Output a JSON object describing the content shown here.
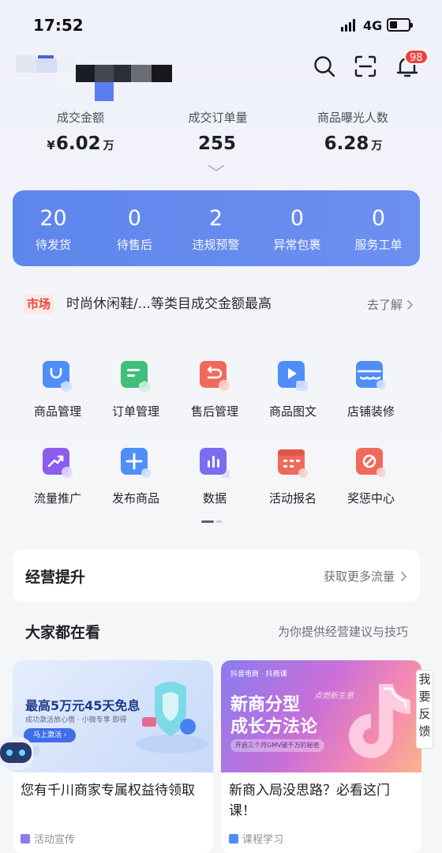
{
  "status_bar": {
    "time": "17:52",
    "network": "4G"
  },
  "header": {
    "notification_count": "98"
  },
  "metrics": [
    {
      "label": "成交金额",
      "currency": "¥",
      "value": "6.02",
      "unit": "万"
    },
    {
      "label": "成交订单量",
      "currency": "",
      "value": "255",
      "unit": ""
    },
    {
      "label": "商品曝光人数",
      "currency": "",
      "value": "6.28",
      "unit": "万"
    }
  ],
  "order_stats": [
    {
      "count": "20",
      "label": "待发货"
    },
    {
      "count": "0",
      "label": "待售后"
    },
    {
      "count": "2",
      "label": "违规预警"
    },
    {
      "count": "0",
      "label": "异常包裹"
    },
    {
      "count": "0",
      "label": "服务工单"
    }
  ],
  "market": {
    "tag": "市场",
    "text": "时尚休闲鞋/...等类目成交金额最高",
    "link": "去了解"
  },
  "tools": [
    {
      "label": "商品管理",
      "icon": "product-manage-icon",
      "color": "#4f8ef7"
    },
    {
      "label": "订单管理",
      "icon": "order-manage-icon",
      "color": "#3fbf7a"
    },
    {
      "label": "售后管理",
      "icon": "after-sale-icon",
      "color": "#f06a5b"
    },
    {
      "label": "商品图文",
      "icon": "product-media-icon",
      "color": "#4f8ef7"
    },
    {
      "label": "店铺装修",
      "icon": "shop-decor-icon",
      "color": "#4f8ef7"
    },
    {
      "label": "流量推广",
      "icon": "traffic-promo-icon",
      "color": "#8a5cf0"
    },
    {
      "label": "发布商品",
      "icon": "publish-product-icon",
      "color": "#4f8ef7"
    },
    {
      "label": "数据",
      "icon": "data-icon",
      "color": "#7b6cf0"
    },
    {
      "label": "活动报名",
      "icon": "activity-signup-icon",
      "color": "#f06a5b"
    },
    {
      "label": "奖惩中心",
      "icon": "reward-penalty-icon",
      "color": "#f06a5b"
    }
  ],
  "business": {
    "title": "经营提升",
    "link": "获取更多流量"
  },
  "feed_section": {
    "title": "大家都在看",
    "subtitle": "为你提供经营建议与技巧"
  },
  "feed": [
    {
      "banner_headline": "最高5万元45天免息",
      "banner_sub": "成功激活放心借 · 小微专享 即得",
      "banner_button": "马上激活 ›",
      "title": "您有千川商家专属权益待领取",
      "tag": "活动宣传"
    },
    {
      "banner_brand": "抖音电商",
      "banner_brand2": "抖商课",
      "banner_headline_1": "新商分型",
      "banner_headline_2": "成长方法论",
      "banner_accent": "点燃新生意",
      "banner_sub": "开启三个月GMV破千万的秘密",
      "title": "新商入局没思路？必看这门课！",
      "tag": "课程学习"
    }
  ],
  "feedback": {
    "label": "我要反馈"
  },
  "colors": {
    "accent": "#5d86ec",
    "badge": "#f1413a",
    "market_tag": "#e8473b"
  }
}
